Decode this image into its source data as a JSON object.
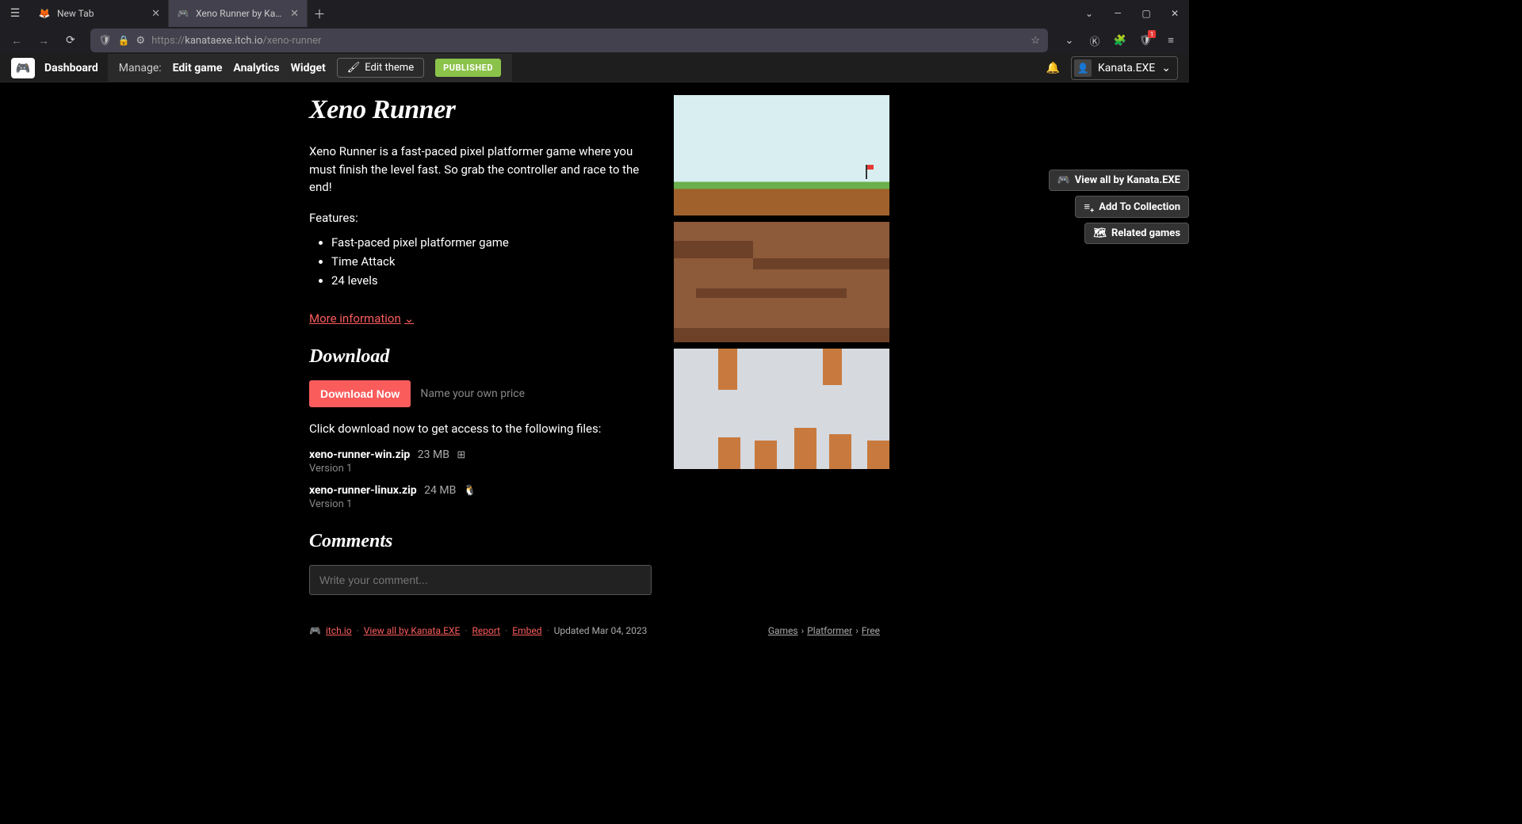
{
  "browser": {
    "tabs": [
      {
        "label": "New Tab",
        "active": false
      },
      {
        "label": "Xeno Runner by Kanata.EXE",
        "active": true
      }
    ],
    "url_prefix": "https://",
    "url_host": "kanataexe.itch.io",
    "url_path": "/xeno-runner"
  },
  "itch_bar": {
    "dashboard": "Dashboard",
    "manage_label": "Manage:",
    "links": {
      "edit_game": "Edit game",
      "analytics": "Analytics",
      "widget": "Widget"
    },
    "edit_theme": "Edit theme",
    "published": "PUBLISHED",
    "username": "Kanata.EXE"
  },
  "side_actions": {
    "view_all": "View all by Kanata.EXE",
    "add_collection": "Add To Collection",
    "related": "Related games"
  },
  "game": {
    "title": "Xeno Runner",
    "description": "Xeno Runner is a fast-paced pixel platformer game where you must finish the level fast. So grab the controller and race to the end!",
    "features_heading": "Features:",
    "features": [
      "Fast-paced pixel platformer game",
      "Time Attack",
      "24 levels"
    ],
    "more_info": "More information"
  },
  "download": {
    "heading": "Download",
    "button": "Download Now",
    "price_note": "Name your own price",
    "access_note": "Click download now to get access to the following files:",
    "files": [
      {
        "name": "xeno-runner-win.zip",
        "size": "23 MB",
        "os": "windows",
        "version": "Version 1"
      },
      {
        "name": "xeno-runner-linux.zip",
        "size": "24 MB",
        "os": "linux",
        "version": "Version 1"
      }
    ]
  },
  "comments": {
    "heading": "Comments",
    "placeholder": "Write your comment..."
  },
  "footer": {
    "itch": "itch.io",
    "view_all": "View all by Kanata.EXE",
    "report": "Report",
    "embed": "Embed",
    "updated": "Updated Mar 04, 2023",
    "cat_games": "Games",
    "cat_platformer": "Platformer",
    "cat_free": "Free"
  }
}
